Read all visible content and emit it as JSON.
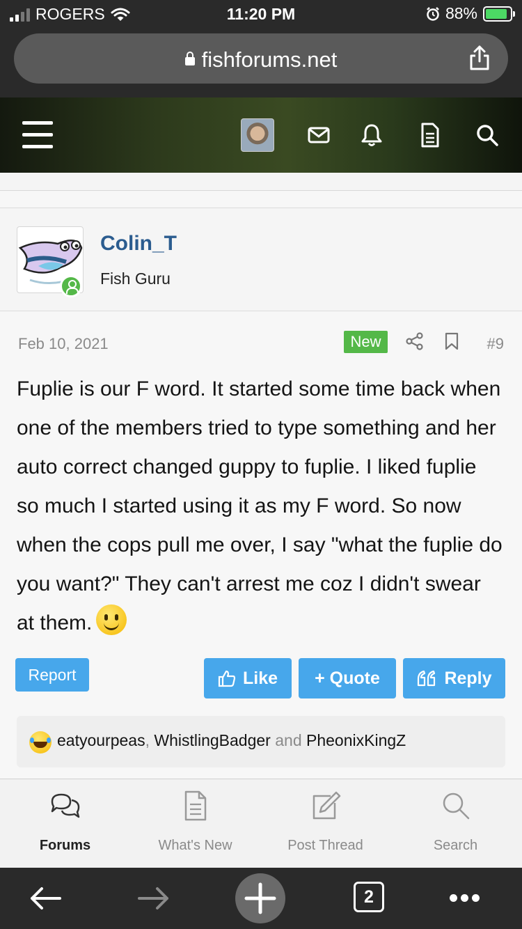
{
  "status_bar": {
    "carrier": "ROGERS",
    "time": "11:20 PM",
    "battery": "88%"
  },
  "browser": {
    "url": "fishforums.net",
    "tabs_count": "2"
  },
  "post": {
    "author": "Colin_T",
    "author_title": "Fish Guru",
    "date": "Feb 10, 2021",
    "badge": "New",
    "number": "#9",
    "body": "Fuplie is our F word. It started some time back when one of the members tried to type something and her auto correct changed guppy to fuplie. I liked fuplie so much I started using it as my F word. So now when the cops pull me over, I say \"what the fuplie do you want?\" They can't arrest me coz I didn't swear at them.",
    "report_label": "Report",
    "like_label": "Like",
    "quote_label": "+ Quote",
    "reply_label": "Reply",
    "reactions": {
      "user1": "eatyourpeas",
      "separator": ",",
      "user2": "WhistlingBadger",
      "and": "and",
      "user3": "PheonixKingZ"
    }
  },
  "tab_bar": {
    "forums": "Forums",
    "whats_new": "What's New",
    "post_thread": "Post Thread",
    "search": "Search"
  },
  "colors": {
    "accent": "#47a7eb",
    "link": "#2b5c8f",
    "new_badge": "#54b848"
  }
}
